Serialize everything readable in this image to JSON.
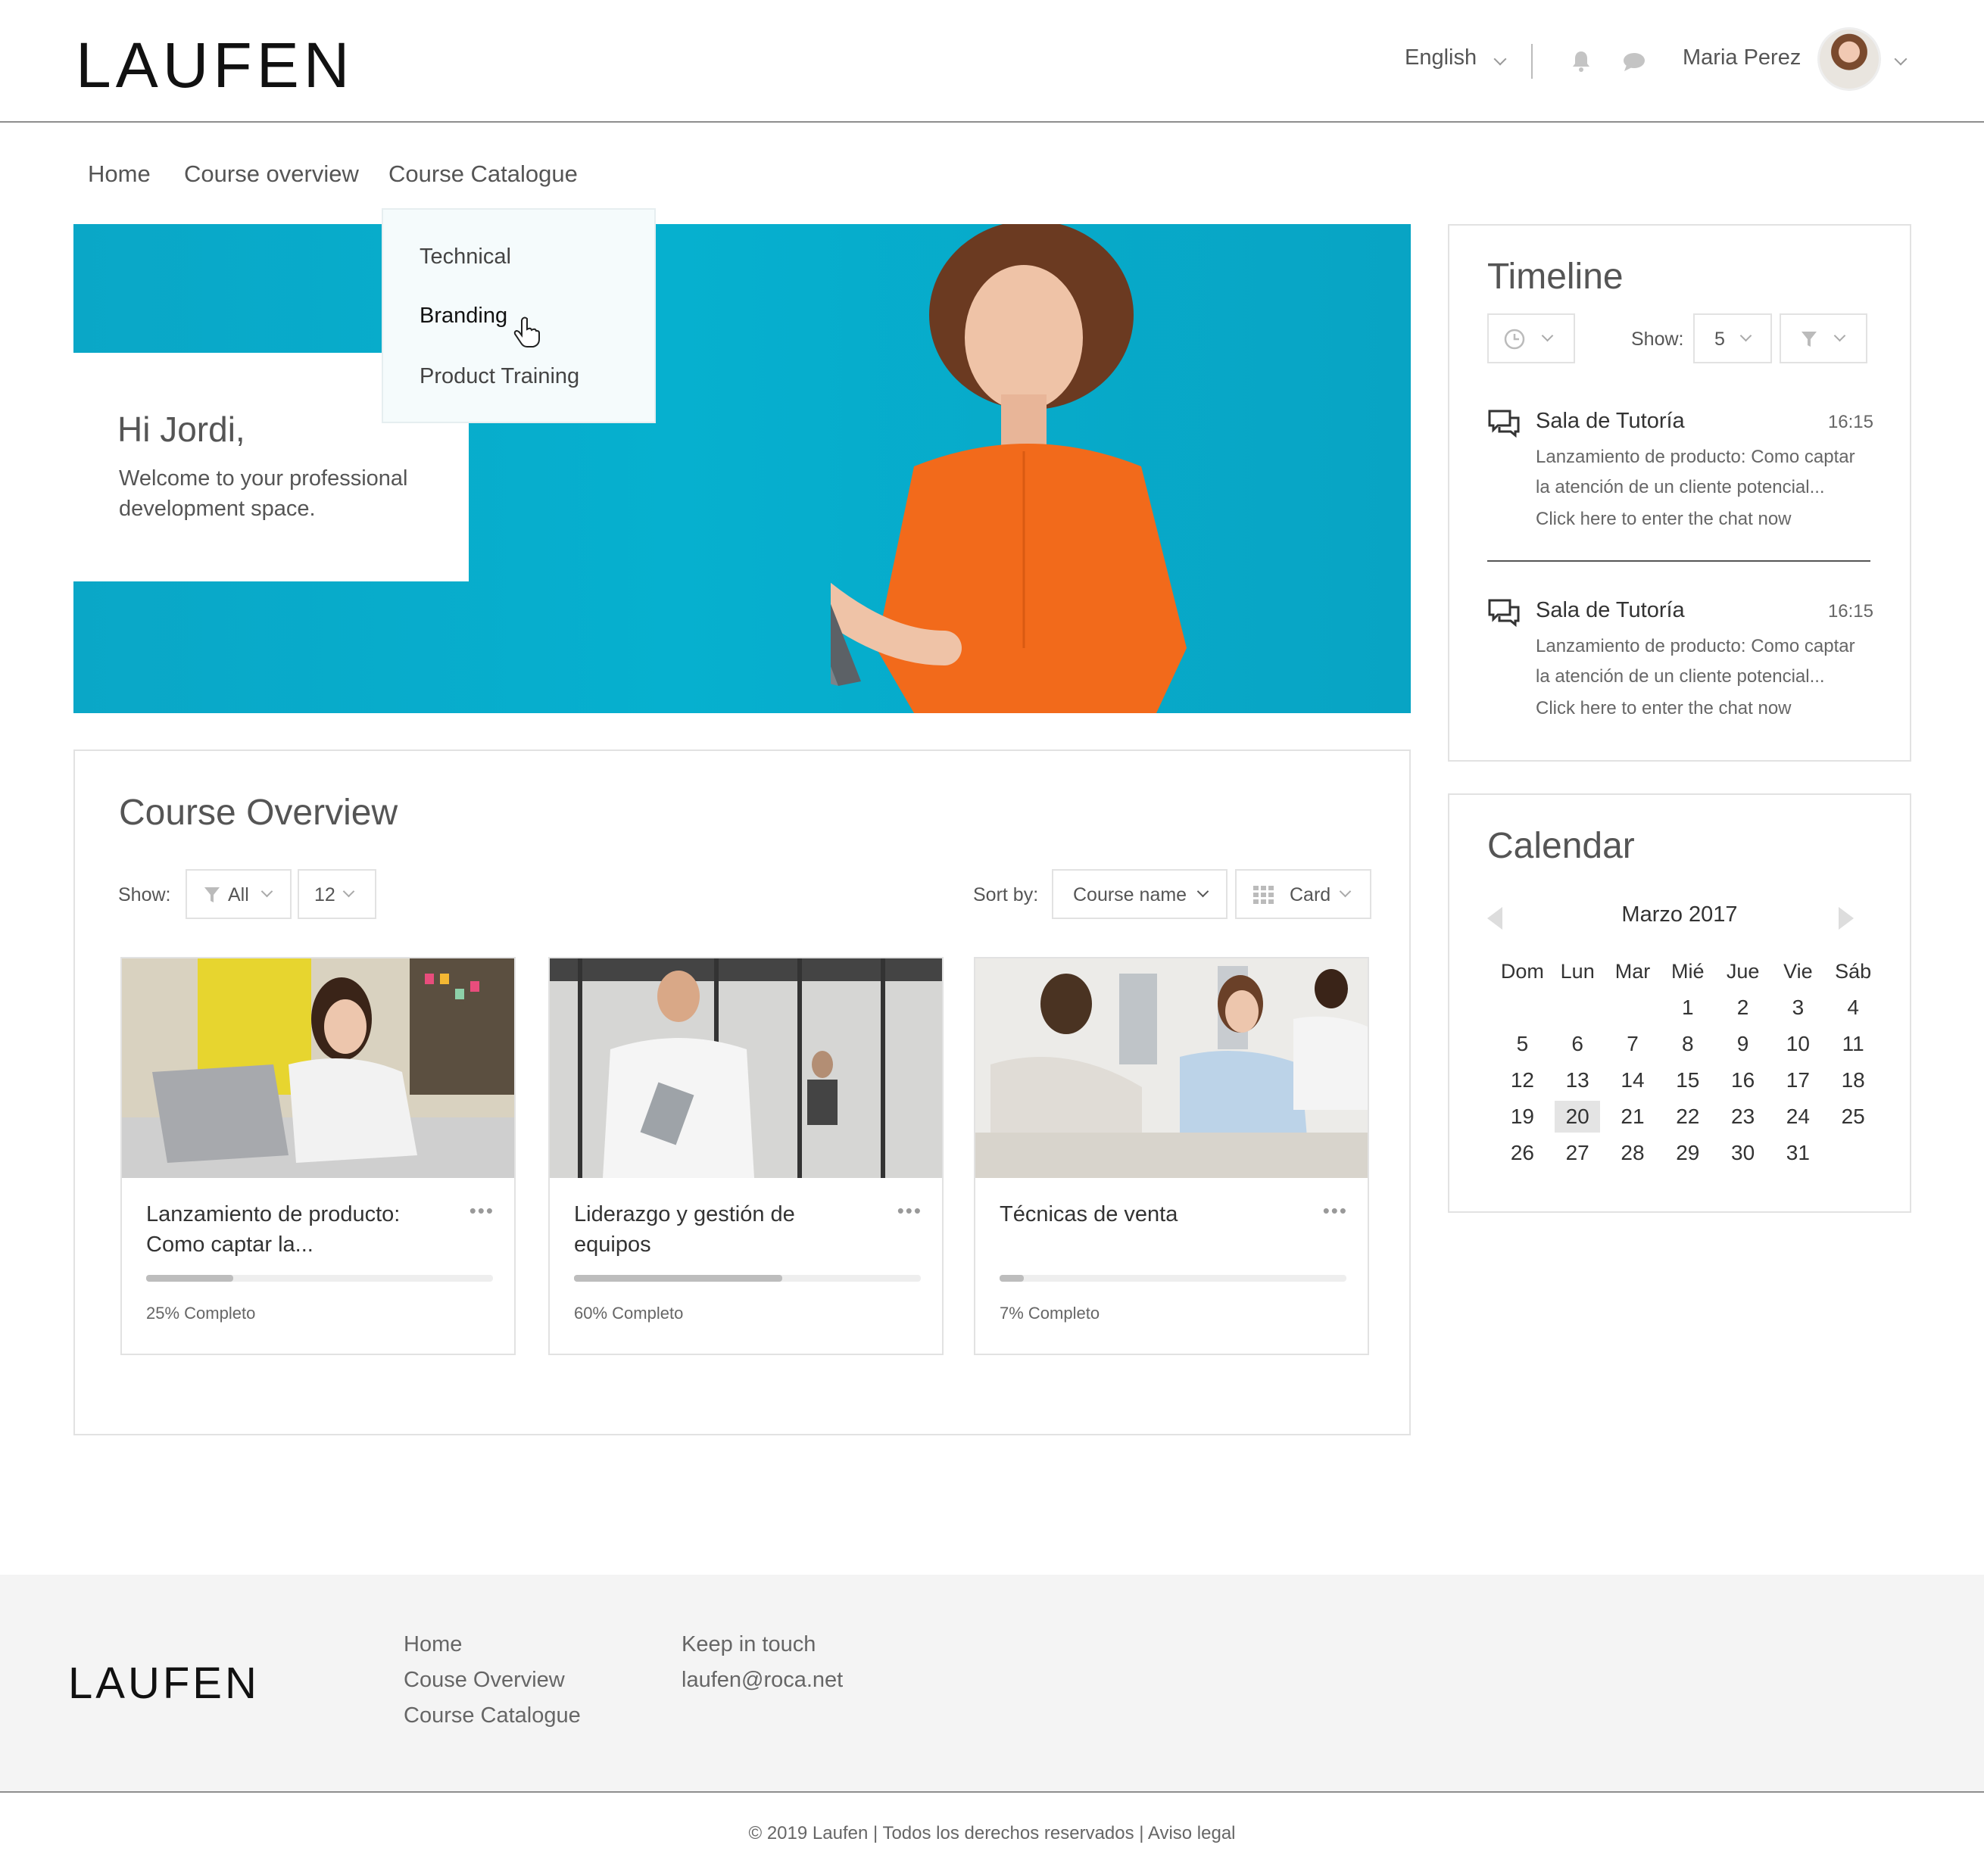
{
  "header": {
    "logo": "LAUFEN",
    "language": "English",
    "user_name": "Maria Perez"
  },
  "nav": {
    "items": [
      "Home",
      "Course overview",
      "Course Catalogue"
    ]
  },
  "dropdown": {
    "items": [
      "Technical",
      "Branding",
      "Product Training"
    ],
    "hovered": "Branding"
  },
  "hero": {
    "greeting": "Hi Jordi,",
    "subtitle": "Welcome to your professional development space."
  },
  "course_overview": {
    "title": "Course Overview",
    "show_label": "Show:",
    "filter_value": "All",
    "count_value": "12",
    "sort_label": "Sort by:",
    "sort_value": "Course name",
    "view_value": "Card",
    "cards": [
      {
        "title": "Lanzamiento de producto: Como captar la...",
        "progress": 25,
        "progress_label": "25%  Completo"
      },
      {
        "title": "Liderazgo y gestión de equipos",
        "progress": 60,
        "progress_label": "60%  Completo"
      },
      {
        "title": "Técnicas de venta",
        "progress": 7,
        "progress_label": "7%  Completo"
      }
    ]
  },
  "timeline": {
    "title": "Timeline",
    "show_label": "Show:",
    "show_value": "5",
    "items": [
      {
        "title": "Sala de Tutoría",
        "time": "16:15",
        "desc": "Lanzamiento de producto: Como captar la atención de un cliente potencial...",
        "link": "Click here to enter the chat now"
      },
      {
        "title": "Sala de Tutoría",
        "time": "16:15",
        "desc": "Lanzamiento de producto: Como captar la atención de un cliente potencial...",
        "link": "Click here to enter the chat now"
      }
    ]
  },
  "calendar": {
    "title": "Calendar",
    "month": "Marzo 2017",
    "weekdays": [
      "Dom",
      "Lun",
      "Mar",
      "Mié",
      "Jue",
      "Vie",
      "Sáb"
    ],
    "weeks": [
      [
        "",
        "",
        "",
        "1",
        "2",
        "3",
        "4"
      ],
      [
        "5",
        "6",
        "7",
        "8",
        "9",
        "10",
        "11"
      ],
      [
        "12",
        "13",
        "14",
        "15",
        "16",
        "17",
        "18"
      ],
      [
        "19",
        "20",
        "21",
        "22",
        "23",
        "24",
        "25"
      ],
      [
        "26",
        "27",
        "28",
        "29",
        "30",
        "31",
        ""
      ]
    ],
    "today": "20"
  },
  "footer": {
    "logo": "LAUFEN",
    "links": [
      "Home",
      "Couse Overview",
      "Course Catalogue"
    ],
    "contact_title": "Keep in touch",
    "email": "laufen@roca.net",
    "copyright": "© 2019 Laufen | Todos los derechos reservados | Aviso legal"
  },
  "colors": {
    "hero_bg": "#06b0cf",
    "accent_dress": "#f26a1b",
    "progress_fill": "#bdbdbd"
  }
}
